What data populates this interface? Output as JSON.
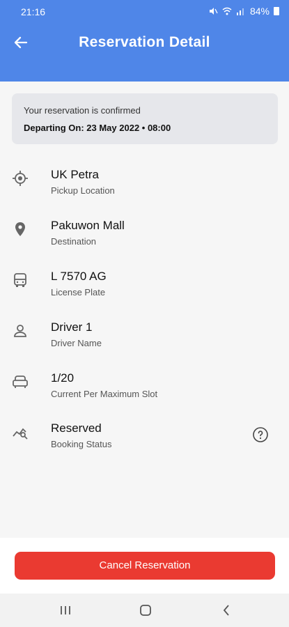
{
  "status_bar": {
    "time": "21:16",
    "battery": "84%",
    "icons": [
      "mute-icon",
      "wifi-icon",
      "signal-icon",
      "battery-icon"
    ]
  },
  "header": {
    "title": "Reservation Detail",
    "back_icon": "arrow-left-icon"
  },
  "confirmation": {
    "message": "Your reservation is confirmed",
    "departure": "Departing On: 23 May 2022 • 08:00"
  },
  "details": [
    {
      "value": "UK Petra",
      "label": "Pickup Location",
      "icon": "target-location-icon"
    },
    {
      "value": "Pakuwon Mall",
      "label": "Destination",
      "icon": "map-pin-icon"
    },
    {
      "value": "L 7570 AG",
      "label": "License Plate",
      "icon": "bus-icon"
    },
    {
      "value": "Driver 1",
      "label": "Driver Name",
      "icon": "person-icon"
    },
    {
      "value": "1/20",
      "label": "Current Per Maximum Slot",
      "icon": "seat-icon"
    },
    {
      "value": "Reserved",
      "label": "Booking Status",
      "icon": "status-search-icon",
      "help_icon": "help-circle-icon"
    }
  ],
  "actions": {
    "cancel_label": "Cancel Reservation"
  },
  "colors": {
    "primary": "#4f86e8",
    "danger": "#ea3a31",
    "background": "#f6f6f6",
    "banner": "#e6e7eb"
  }
}
